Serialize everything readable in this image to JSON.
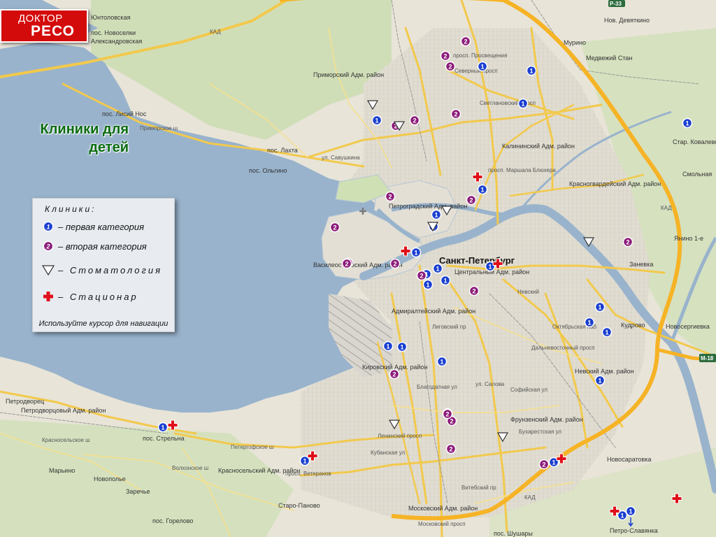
{
  "brand": {
    "line1": "ДОКТОР",
    "line2": "РЕСО",
    "color": "#d40b0b"
  },
  "title": {
    "line1": "Клиники для",
    "line2": "детей",
    "color": "#0a6b10"
  },
  "legend": {
    "heading": "Клиники:",
    "items": [
      {
        "symbol": "1",
        "label": "–  первая категория"
      },
      {
        "symbol": "2",
        "label": "–  вторая категория"
      },
      {
        "symbol": "triangle-icon",
        "label": "– Стоматология"
      },
      {
        "symbol": "cross-icon",
        "label": "– Стационар"
      }
    ],
    "hint": "Используйте курсор для навигации"
  },
  "colors": {
    "first_category": "#1a3fd0",
    "second_category": "#8c1c7a",
    "hospital": "#e0101a",
    "dental": "#ffffff",
    "water": "#99b3cc",
    "land": "#e7e3d6",
    "road_major": "#f2c94c",
    "ring_road": "#f6b325"
  },
  "map_labels": [
    "Санкт-Петербург",
    "Приморский Адм. район",
    "Петроградский Адм. район",
    "Василеостровский Адм. район",
    "Центральный Адм. район",
    "Адмиралтейский Адм. район",
    "Кировский Адм. район",
    "Фрунзенский Адм. район",
    "Невский Адм. район",
    "Калининский Адм. район",
    "Красногвардейский Адм. район",
    "Красносельский Адм. район",
    "Петродворцовый Адм. район",
    "Московский Адм. район",
    "пос. Новоселки",
    "Юнтоловская",
    "Александровская",
    "пос. Лисий Нос",
    "пос. Лахта",
    "пос. Ольгино",
    "пос. Стрельна",
    "Петродворец",
    "Марьино",
    "Новополье",
    "Заречье",
    "пос. Горелово",
    "Старо-Паново",
    "пос. Шушары",
    "Петро-Славянка",
    "Новосаратовка",
    "Кудрово",
    "Новосергиевка",
    "Заневка",
    "Янино 1-е",
    "Смольная",
    "Стар. Ковалево",
    "Медвежий Стан",
    "Нов. Девяткино",
    "Мурино",
    "КАД",
    "Приморское ш",
    "Петергофское ш",
    "Ленинский просп",
    "просп. Ветеранов",
    "Московский просп",
    "Лиговский пр",
    "Невский",
    "Дальневосточный просп",
    "Октябрьская наб",
    "ул. Савушкина",
    "Северный просп",
    "просп. Просвещения",
    "Светлановский просп",
    "просп. Маршала Блюхера",
    "Кубанская ул",
    "Благодатная ул",
    "ул. Салова",
    "Софийская ул",
    "Витебский пр",
    "Бухарестская ул",
    "Красносельское ш",
    "Волхонское ш",
    "М-18",
    "Р-33"
  ],
  "clinics": {
    "first_category": [
      {
        "id": "p1-01"
      },
      {
        "id": "p1-02"
      },
      {
        "id": "p1-03"
      },
      {
        "id": "p1-04"
      },
      {
        "id": "p1-05"
      },
      {
        "id": "p1-06"
      },
      {
        "id": "p1-07"
      },
      {
        "id": "p1-08"
      },
      {
        "id": "p1-09"
      },
      {
        "id": "p1-10"
      },
      {
        "id": "p1-11"
      },
      {
        "id": "p1-12"
      },
      {
        "id": "p1-13"
      },
      {
        "id": "p1-14"
      },
      {
        "id": "p1-15"
      },
      {
        "id": "p1-16"
      },
      {
        "id": "p1-17"
      },
      {
        "id": "p1-18"
      },
      {
        "id": "p1-19"
      },
      {
        "id": "p1-20"
      },
      {
        "id": "p1-21"
      },
      {
        "id": "p1-22"
      },
      {
        "id": "p1-23"
      },
      {
        "id": "p1-24"
      },
      {
        "id": "p1-25"
      },
      {
        "id": "p1-26"
      }
    ],
    "second_category": [
      {
        "id": "p2-01"
      },
      {
        "id": "p2-02"
      },
      {
        "id": "p2-03"
      },
      {
        "id": "p2-04"
      },
      {
        "id": "p2-05"
      },
      {
        "id": "p2-06"
      },
      {
        "id": "p2-07"
      },
      {
        "id": "p2-08"
      },
      {
        "id": "p2-09"
      },
      {
        "id": "p2-10"
      },
      {
        "id": "p2-11"
      },
      {
        "id": "p2-12"
      },
      {
        "id": "p2-13"
      },
      {
        "id": "p2-14"
      },
      {
        "id": "p2-15"
      },
      {
        "id": "p2-16"
      },
      {
        "id": "p2-17"
      },
      {
        "id": "p2-18"
      },
      {
        "id": "p2-19"
      },
      {
        "id": "p2-20"
      },
      {
        "id": "p2-21"
      }
    ],
    "dental": [
      {
        "id": "d-01"
      },
      {
        "id": "d-02"
      },
      {
        "id": "d-03"
      },
      {
        "id": "d-04"
      },
      {
        "id": "d-05"
      },
      {
        "id": "d-06"
      },
      {
        "id": "d-07"
      }
    ],
    "hospital": [
      {
        "id": "h-01"
      },
      {
        "id": "h-02"
      },
      {
        "id": "h-03"
      },
      {
        "id": "h-04"
      },
      {
        "id": "h-05"
      },
      {
        "id": "h-06"
      },
      {
        "id": "h-07"
      },
      {
        "id": "h-08"
      }
    ]
  }
}
